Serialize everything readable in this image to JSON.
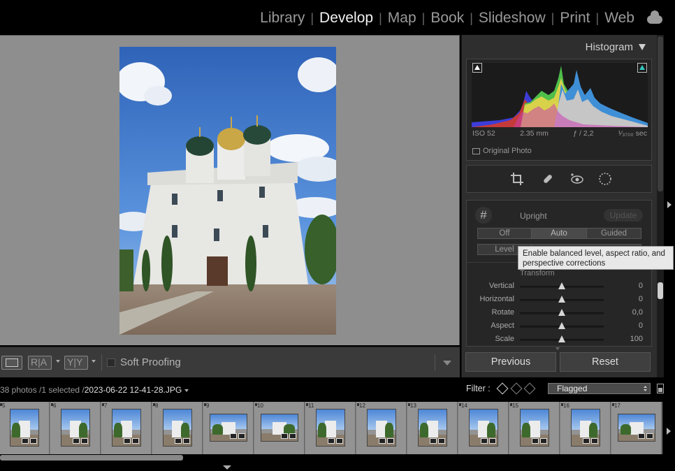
{
  "modules": {
    "items": [
      {
        "label": "Library"
      },
      {
        "label": "Develop"
      },
      {
        "label": "Map"
      },
      {
        "label": "Book"
      },
      {
        "label": "Slideshow"
      },
      {
        "label": "Print"
      },
      {
        "label": "Web"
      }
    ],
    "active": "Develop",
    "cloud_icon": "cloud-icon"
  },
  "toolbar": {
    "view_icon": "loupe-view-icon",
    "before_after_label": "R|A",
    "yy_label": "Y|Y",
    "soft_proofing_label": "Soft Proofing",
    "soft_proofing_checked": false
  },
  "histogram": {
    "title": "Histogram",
    "iso": "ISO 52",
    "focal": "2.35 mm",
    "aperture": "ƒ / 2,2",
    "shutter": "¹⁄₃₇₀₀ sec",
    "original_photo_label": "Original Photo",
    "shadow_clip_color": "#ffffff",
    "highlight_clip_color": "#34c6c0"
  },
  "tools": [
    "crop-icon",
    "healing-icon",
    "red-eye-icon",
    "masking-icon"
  ],
  "transform": {
    "upright_label": "Upright",
    "update_label": "Update",
    "upright_modes": [
      {
        "label": "Off"
      },
      {
        "label": "Auto"
      },
      {
        "label": "Guided"
      }
    ],
    "upright_modes_row2": [
      {
        "label": "Level"
      }
    ],
    "section_label": "Transform",
    "sliders": [
      {
        "label": "Vertical",
        "value": "0",
        "level": 0.5
      },
      {
        "label": "Horizontal",
        "value": "0",
        "level": 0.5
      },
      {
        "label": "Rotate",
        "value": "0,0",
        "level": 0.5
      },
      {
        "label": "Aspect",
        "value": "0",
        "level": 0.5
      },
      {
        "label": "Scale",
        "value": "100",
        "level": 0.5
      }
    ]
  },
  "tooltip": "Enable balanced level, aspect ratio, and perspective corrections",
  "actions": {
    "previous_label": "Previous",
    "reset_label": "Reset"
  },
  "filmstrip": {
    "info_prefix": "38 photos /1 selected /",
    "filename": "2023-06-22 12-41-28.JPG",
    "filter_label": "Filter :",
    "filter_value": "Flagged",
    "cells": [
      {
        "num": "5"
      },
      {
        "num": "6"
      },
      {
        "num": "7"
      },
      {
        "num": "8"
      },
      {
        "num": "9"
      },
      {
        "num": "10"
      },
      {
        "num": "11"
      },
      {
        "num": "12"
      },
      {
        "num": "13"
      },
      {
        "num": "14"
      },
      {
        "num": "15"
      },
      {
        "num": "16"
      },
      {
        "num": "17"
      }
    ]
  }
}
